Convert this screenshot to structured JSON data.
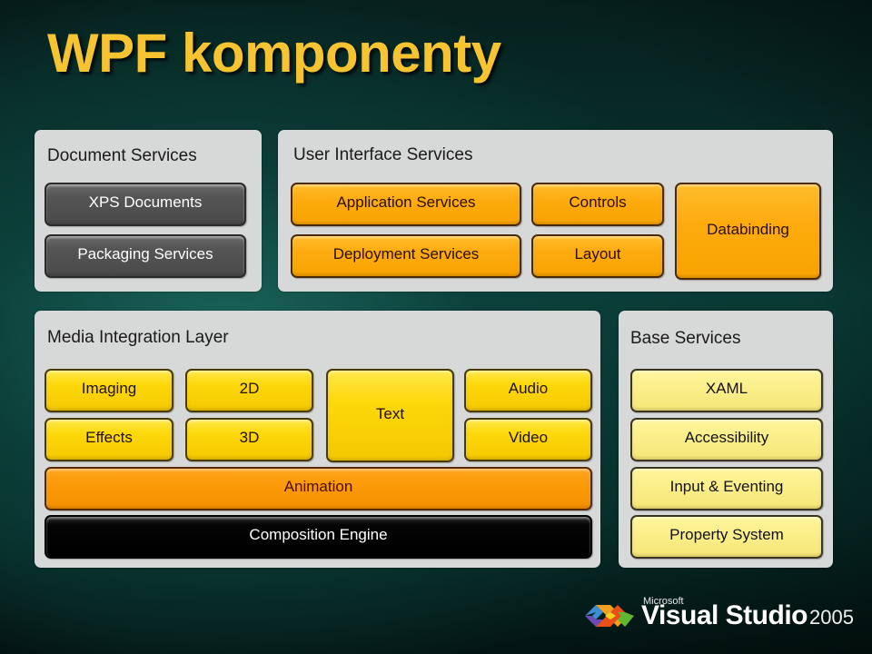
{
  "slide": {
    "title": "WPF komponenty"
  },
  "document_services": {
    "title": "Document Services",
    "items": [
      {
        "label": "XPS Documents"
      },
      {
        "label": "Packaging Services"
      }
    ]
  },
  "ui_services": {
    "title": "User Interface Services",
    "items": [
      {
        "label": "Application Services"
      },
      {
        "label": "Deployment Services"
      },
      {
        "label": "Controls"
      },
      {
        "label": "Layout"
      },
      {
        "label": "Databinding"
      }
    ]
  },
  "media_layer": {
    "title": "Media Integration Layer",
    "items": [
      {
        "label": "Imaging"
      },
      {
        "label": "Effects"
      },
      {
        "label": "2D"
      },
      {
        "label": "3D"
      },
      {
        "label": "Text"
      },
      {
        "label": "Audio"
      },
      {
        "label": "Video"
      },
      {
        "label": "Animation"
      },
      {
        "label": "Composition Engine"
      }
    ]
  },
  "base_services": {
    "title": "Base Services",
    "items": [
      {
        "label": "XAML"
      },
      {
        "label": "Accessibility"
      },
      {
        "label": "Input & Eventing"
      },
      {
        "label": "Property System"
      }
    ]
  },
  "logo": {
    "company": "Microsoft",
    "product": "Visual Studio",
    "year": "2005"
  },
  "colors": {
    "title": "#f7c431",
    "panel": "#d7d8d8",
    "dark_box": "#555555",
    "orange_box": "#fdab0f",
    "yellow_box": "#fdd80a",
    "pale_box": "#fbef8c",
    "animation_box": "#fc9a08",
    "composition_box": "#000000"
  }
}
